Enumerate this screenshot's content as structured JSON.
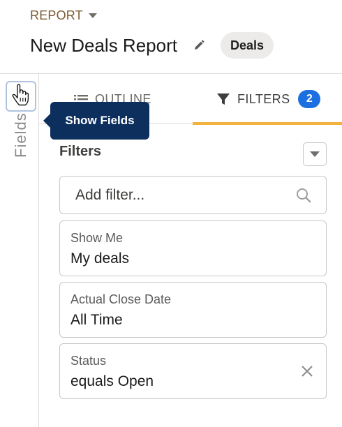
{
  "header": {
    "eyebrow": "REPORT",
    "title": "New Deals Report",
    "object_pill": "Deals"
  },
  "rail": {
    "label": "Fields"
  },
  "tooltip": {
    "text": "Show Fields"
  },
  "tabs": [
    {
      "label": "OUTLINE",
      "icon": "list-icon"
    },
    {
      "label": "FILTERS",
      "icon": "funnel-icon",
      "count": "2"
    }
  ],
  "filters_panel": {
    "heading": "Filters",
    "add_placeholder": "Add filter...",
    "items": [
      {
        "label": "Show Me",
        "value": "My deals"
      },
      {
        "label": "Actual Close Date",
        "value": "All Time"
      },
      {
        "label": "Status",
        "value": "equals Open",
        "removable": true
      }
    ]
  },
  "colors": {
    "accent": "#f1b23f",
    "badge": "#1b6fe0",
    "tooltip": "#0d2f5e",
    "eyebrow": "#7a5b33"
  }
}
